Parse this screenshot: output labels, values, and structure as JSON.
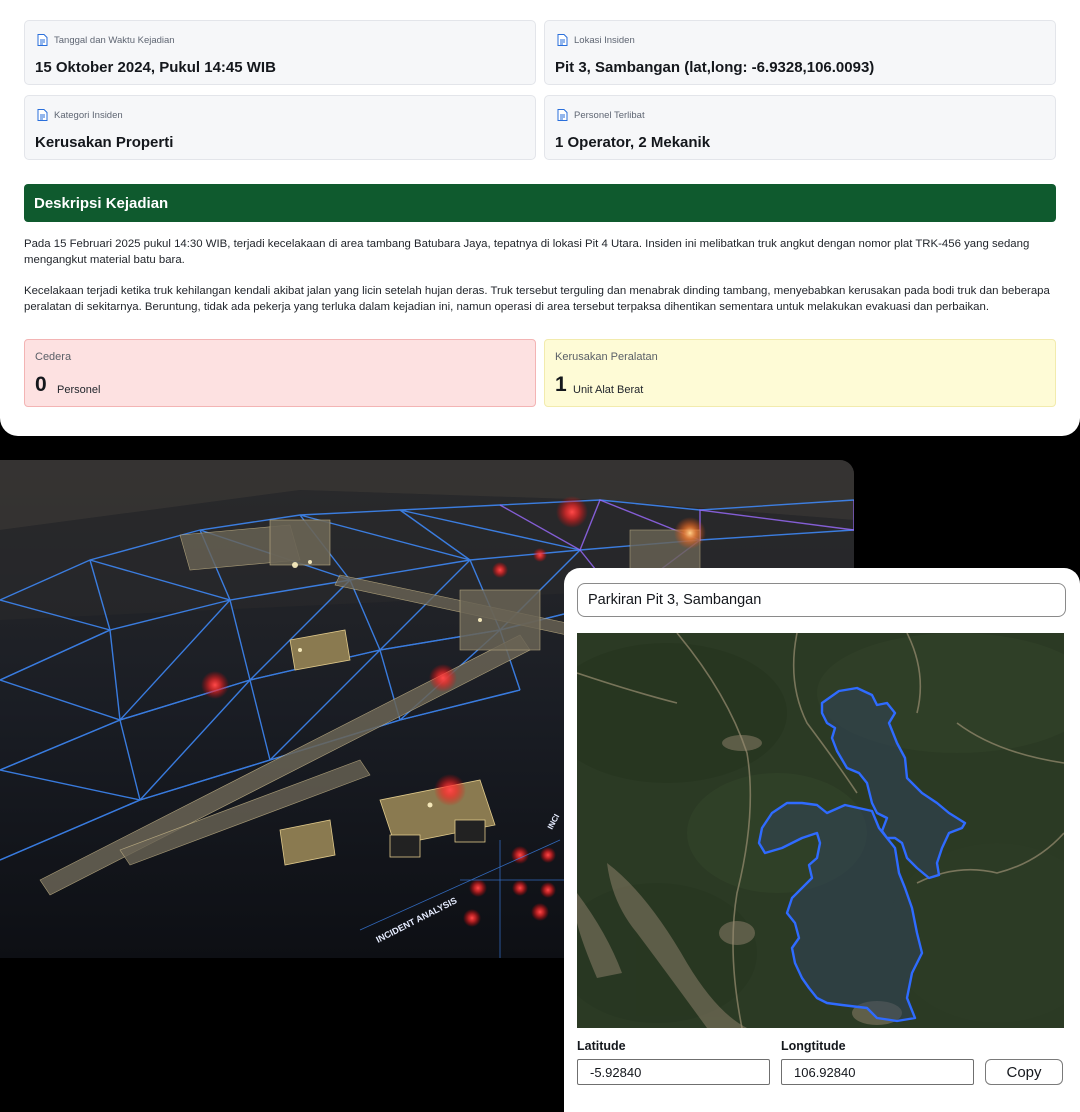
{
  "report": {
    "cards": [
      {
        "label": "Tanggal dan Waktu Kejadian",
        "value": "15 Oktober 2024, Pukul 14:45 WIB",
        "icon": "document-icon"
      },
      {
        "label": "Lokasi Insiden",
        "value": "Pit 3, Sambangan (lat,long: -6.9328,106.0093)",
        "icon": "document-icon"
      },
      {
        "label": "Kategori Insiden",
        "value": "Kerusakan Properti",
        "icon": "document-icon"
      },
      {
        "label": "Personel Terlibat",
        "value": "1 Operator, 2 Mekanik",
        "icon": "document-icon"
      }
    ],
    "section_title": "Deskripsi Kejadian",
    "paragraphs": [
      "Pada 15 Februari 2025 pukul 14:30 WIB, terjadi kecelakaan di area tambang Batubara Jaya, tepatnya di lokasi Pit 4 Utara. Insiden ini melibatkan truk angkut dengan nomor plat TRK-456 yang sedang mengangkut material batu bara.",
      "Kecelakaan terjadi ketika truk kehilangan kendali akibat jalan yang licin setelah hujan deras. Truk tersebut terguling dan menabrak dinding tambang, menyebabkan kerusakan pada bodi truk dan beberapa peralatan di sekitarnya. Beruntung, tidak ada pekerja yang terluka dalam kejadian ini, namun operasi di area tersebut terpaksa dihentikan sementara untuk melakukan evakuasi dan perbaikan."
    ],
    "stats": {
      "injury": {
        "label": "Cedera",
        "value": "0",
        "unit": "Personel",
        "color": "#fde1e1"
      },
      "damage": {
        "label": "Kerusakan Peralatan",
        "value": "1",
        "unit": "Unit Alat Berat",
        "color": "#fefbd6"
      }
    },
    "accent": "#0f5a2e"
  },
  "image": {
    "overlay_text_1": "INCIDENT ANALYSIS",
    "overlay_text_2": "INCI"
  },
  "location": {
    "search_value": "Parkiran Pit 3, Sambangan",
    "latitude_label": "Latitude",
    "latitude_value": "-5.92840",
    "longitude_label": "Longtitude",
    "longitude_value": "106.92840",
    "copy_label": "Copy",
    "polygon_color": "#2f6bff"
  }
}
